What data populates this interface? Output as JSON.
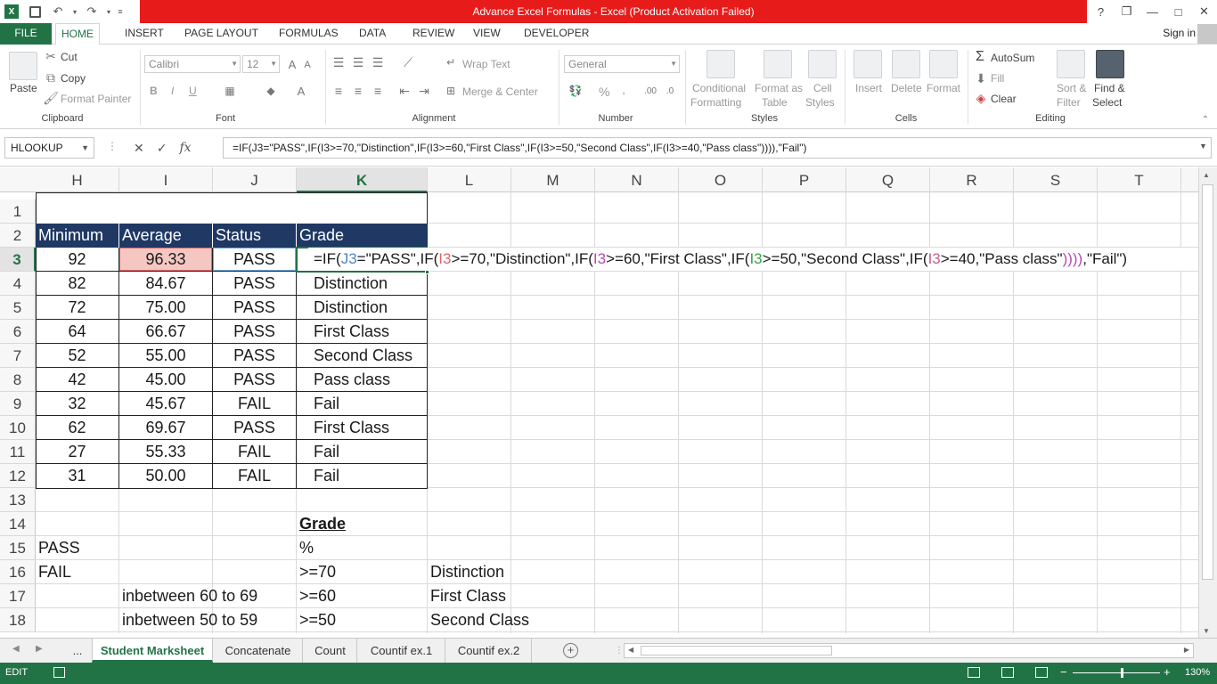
{
  "window": {
    "title": "Advance Excel Formulas -  Excel (Product Activation Failed)",
    "help": "?",
    "restore": "❐",
    "minimize": "—",
    "maximize": "□",
    "close": "✕"
  },
  "ribbon_tabs": [
    "FILE",
    "HOME",
    "INSERT",
    "PAGE LAYOUT",
    "FORMULAS",
    "DATA",
    "REVIEW",
    "VIEW",
    "DEVELOPER"
  ],
  "signin": "Sign in",
  "clipboard": {
    "paste": "Paste",
    "cut": "Cut",
    "copy": "Copy",
    "format_painter": "Format Painter",
    "label": "Clipboard"
  },
  "font": {
    "name": "Calibri",
    "size": "12",
    "bold": "B",
    "italic": "I",
    "underline": "U",
    "label": "Font"
  },
  "alignment": {
    "wrap_text": "Wrap Text",
    "merge_center": "Merge & Center",
    "label": "Alignment"
  },
  "number": {
    "format": "General",
    "percent": "%",
    "label": "Number"
  },
  "styles": {
    "conditional": "Conditional",
    "conditional2": "Formatting",
    "format_as": "Format as",
    "format_as2": "Table",
    "cell_styles": "Cell",
    "cell_styles2": "Styles",
    "label": "Styles"
  },
  "cells_group": {
    "insert": "Insert",
    "delete": "Delete",
    "format": "Format",
    "label": "Cells"
  },
  "editing": {
    "autosum": "AutoSum",
    "fill": "Fill",
    "clear": "Clear",
    "sort": "Sort &",
    "sort2": "Filter",
    "find": "Find &",
    "find2": "Select",
    "label": "Editing"
  },
  "formula_bar": {
    "name_box": "HLOOKUP",
    "cancel": "✕",
    "enter": "✓",
    "fx": "fx",
    "formula": "=IF(J3=\"PASS\",IF(I3>=70,\"Distinction\",IF(I3>=60,\"First Class\",IF(I3>=50,\"Second Class\",IF(I3>=40,\"Pass class\")))),\"Fail\")"
  },
  "columns": [
    "H",
    "I",
    "J",
    "K",
    "L",
    "M",
    "N",
    "O",
    "P",
    "Q",
    "R",
    "S",
    "T"
  ],
  "rows": [
    "1",
    "2",
    "3",
    "4",
    "5",
    "6",
    "7",
    "8",
    "9",
    "10",
    "11",
    "12",
    "13",
    "14",
    "15",
    "16",
    "17",
    "18"
  ],
  "table": {
    "headers": [
      "Minimum",
      "Average",
      "Status",
      "Grade"
    ],
    "data": [
      [
        "92",
        "96.33",
        "PASS",
        ""
      ],
      [
        "82",
        "84.67",
        "PASS",
        "Distinction"
      ],
      [
        "72",
        "75.00",
        "PASS",
        "Distinction"
      ],
      [
        "64",
        "66.67",
        "PASS",
        "First Class"
      ],
      [
        "52",
        "55.00",
        "PASS",
        "Second Class"
      ],
      [
        "42",
        "45.00",
        "PASS",
        "Pass class"
      ],
      [
        "32",
        "45.67",
        "FAIL",
        "Fail"
      ],
      [
        "62",
        "69.67",
        "PASS",
        "First Class"
      ],
      [
        "27",
        "55.33",
        "FAIL",
        "Fail"
      ],
      [
        "31",
        "50.00",
        "FAIL",
        "Fail"
      ]
    ]
  },
  "edit_formula": {
    "p1": "=IF(",
    "ref1": "J3",
    "p2": "=\"PASS\",IF(",
    "ref2": "I3",
    "p3": ">=70,\"Distinction\",IF(",
    "ref3": "I3",
    "p4": ">=60,\"First Class\",IF(",
    "ref4": "I3",
    "p5": ">=50,\"Second Class\",IF(",
    "ref5": "I3",
    "p6": ">=40,\"Pass class\"",
    "p7": "))))",
    "p8": ",\"Fail\")"
  },
  "lower": {
    "grade_title": "Grade",
    "pass": "PASS",
    "fail": "FAIL",
    "percent": "%",
    "ge70": ">=70",
    "distinction": "Distinction",
    "between60": "inbetween 60 to 69",
    "ge60": ">=60",
    "first_class": "First Class",
    "between50": "inbetween 50 to 59",
    "ge50": ">=50",
    "second_class": "Second Class"
  },
  "sheets": {
    "more": "...",
    "tabs": [
      "Student Marksheet",
      "Concatenate",
      "Count",
      "Countif ex.1",
      "Countif ex.2"
    ],
    "add": "+"
  },
  "status": {
    "mode": "EDIT",
    "zoom": "130%"
  },
  "colors": {
    "accent": "#217346",
    "header_fill": "#1f3864",
    "title_red": "#e81b1b",
    "highlight": "#f4c7c3"
  }
}
